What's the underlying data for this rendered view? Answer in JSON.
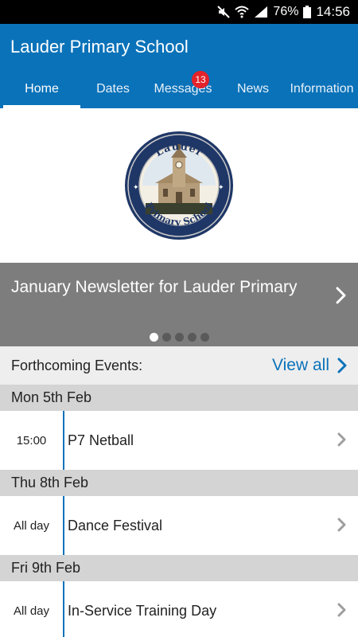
{
  "status_bar": {
    "battery": "76%",
    "time": "14:56"
  },
  "app": {
    "title": "Lauder Primary School",
    "accent": "#0a72b9"
  },
  "tabs": [
    {
      "label": "Home",
      "active": true
    },
    {
      "label": "Dates",
      "active": false
    },
    {
      "label": "Messages",
      "active": false,
      "badge": "13"
    },
    {
      "label": "News",
      "active": false
    },
    {
      "label": "Information",
      "active": false
    }
  ],
  "logo": {
    "top_text": "Lauder",
    "bottom_text": "Primary School"
  },
  "carousel": {
    "text": "January Newsletter for Lauder Primary",
    "slide_count": 5,
    "active_index": 0
  },
  "forthcoming": {
    "label": "Forthcoming Events:",
    "view_all": "View all"
  },
  "events": [
    {
      "date": "Mon 5th Feb",
      "time": "15:00",
      "name": "P7 Netball"
    },
    {
      "date": "Thu 8th Feb",
      "time": "All day",
      "name": "Dance Festival"
    },
    {
      "date": "Fri 9th Feb",
      "time": "All day",
      "name": "In-Service Training Day"
    }
  ]
}
